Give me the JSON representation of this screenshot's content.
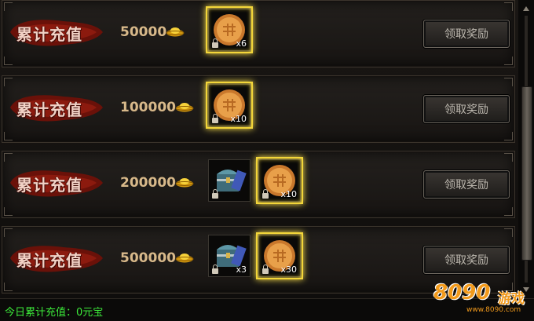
{
  "rows": [
    {
      "label": "累计充值",
      "amount": "50000",
      "rewards": [
        {
          "icon": "mooncake-icon",
          "qty": "x6",
          "glow": true
        }
      ],
      "button": "领取奖励"
    },
    {
      "label": "累计充值",
      "amount": "100000",
      "rewards": [
        {
          "icon": "mooncake-icon",
          "qty": "x10",
          "glow": true
        }
      ],
      "button": "领取奖励"
    },
    {
      "label": "累计充值",
      "amount": "200000",
      "rewards": [
        {
          "icon": "treasure-chest-icon",
          "qty": "",
          "glow": false
        },
        {
          "icon": "mooncake-icon",
          "qty": "x10",
          "glow": true
        }
      ],
      "button": "领取奖励"
    },
    {
      "label": "累计充值",
      "amount": "500000",
      "rewards": [
        {
          "icon": "treasure-chest-icon",
          "qty": "x3",
          "glow": false
        },
        {
          "icon": "mooncake-icon",
          "qty": "x30",
          "glow": true
        }
      ],
      "button": "领取奖励"
    }
  ],
  "footer": {
    "status": "今日累计充值：0元宝"
  },
  "watermark": {
    "brand": "8090",
    "game": "游戏",
    "url": "www.8090.com"
  },
  "colors": {
    "accent_gold": "#f3d63a",
    "footer_green": "#3ce93a",
    "amount_text": "#d8b98a"
  }
}
